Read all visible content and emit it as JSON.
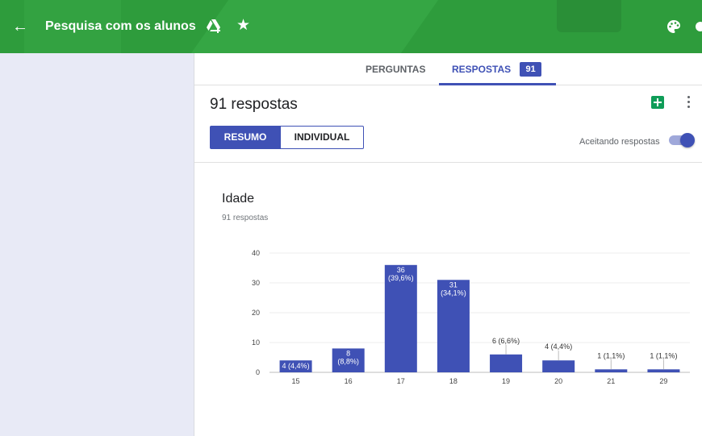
{
  "header": {
    "title": "Pesquisa com os alunos",
    "back_icon": "arrow-left-icon",
    "drive_icon": "drive-add-icon",
    "star_icon": "star-icon",
    "palette_icon": "palette-icon",
    "background_color": "#2e9c3c"
  },
  "tabs": {
    "questions_label": "PERGUNTAS",
    "responses_label": "RESPOSTAS",
    "responses_count": "91",
    "active": "RESPOSTAS",
    "accent_color": "#3f51b5"
  },
  "summary": {
    "response_count_text": "91 respostas",
    "summary_label": "RESUMO",
    "individual_label": "INDIVIDUAL",
    "accepting_label": "Aceitando respostas",
    "accepting_enabled": true
  },
  "question": {
    "title": "Idade",
    "count_text": "91 respostas"
  },
  "chart_data": {
    "type": "bar",
    "categories": [
      "15",
      "16",
      "17",
      "18",
      "19",
      "20",
      "21",
      "29"
    ],
    "values": [
      4,
      8,
      36,
      31,
      6,
      4,
      1,
      1
    ],
    "data_labels": [
      "4 (4,4%)",
      "8 (8,8%)",
      "36 (39,6%)",
      "31 (34,1%)",
      "6 (6,6%)",
      "4 (4,4%)",
      "1 (1,1%)",
      "1 (1,1%)"
    ],
    "y_ticks": [
      0,
      10,
      20,
      30,
      40
    ],
    "ylim": [
      0,
      40
    ],
    "grid": true,
    "bar_color": "#3f51b5"
  }
}
